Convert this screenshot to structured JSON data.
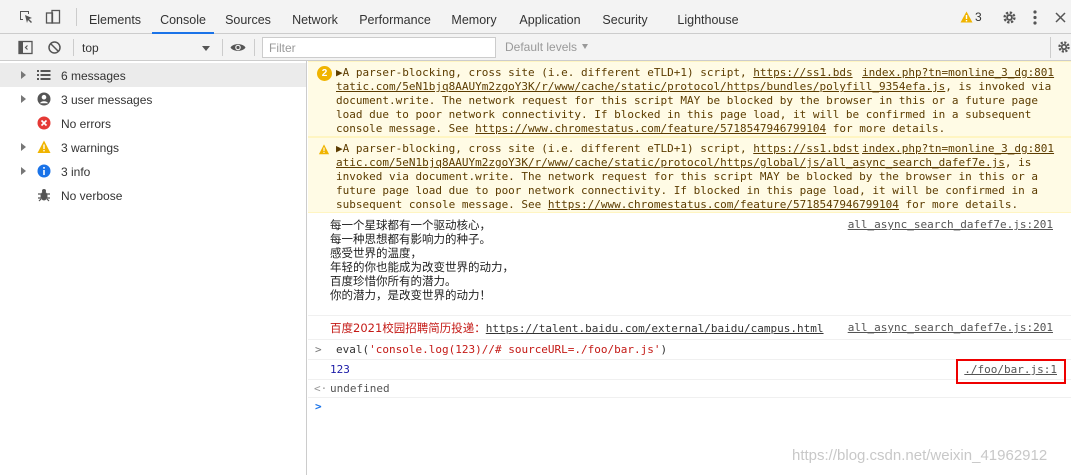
{
  "tabs": {
    "elements": "Elements",
    "console": "Console",
    "sources": "Sources",
    "network": "Network",
    "performance": "Performance",
    "memory": "Memory",
    "application": "Application",
    "security": "Security",
    "lighthouse": "Lighthouse"
  },
  "tabbar_right": {
    "warning_count": "3"
  },
  "toolbar": {
    "context": "top",
    "filter_placeholder": "Filter",
    "levels": "Default levels"
  },
  "sidebar": {
    "items": [
      {
        "label": "6 messages",
        "icon": "list-icon"
      },
      {
        "label": "3 user messages",
        "icon": "user-icon"
      },
      {
        "label": "No errors",
        "icon": "error-icon"
      },
      {
        "label": "3 warnings",
        "icon": "warning-icon"
      },
      {
        "label": "3 info",
        "icon": "info-icon"
      },
      {
        "label": "No verbose",
        "icon": "bug-icon"
      }
    ]
  },
  "console": {
    "warning1": {
      "count": "2",
      "l1a": "▶A parser-blocking, cross site (i.e. different eTLD+1) script, ",
      "l1b": "https://ss1.bds",
      "l1src": "index.php?tn=monline_3_dg:801",
      "l2a": "tatic.com/5eN1bjq8AAUYm2zgoY3K/r/www/cache/static/protocol/https/bundles/polyfill_9354efa.js",
      "l2b": ", is invoked via",
      "l3": "document.write. The network request for this script MAY be blocked by the browser in this or a future page",
      "l4": "load due to poor network connectivity. If blocked in this page load, it will be confirmed in a subsequent",
      "l5a": "console message. See ",
      "l5b": "https://www.chromestatus.com/feature/5718547946799104",
      "l5c": " for more details."
    },
    "warning2": {
      "l1a": "▶A parser-blocking, cross site (i.e. different eTLD+1) script, ",
      "l1b": "https://ss1.bdst",
      "l1src": "index.php?tn=monline_3_dg:801",
      "l2a": "atic.com/5eN1bjq8AAUYm2zgoY3K/r/www/cache/static/protocol/https/global/js/all_async_search_dafef7e.js",
      "l2b": ", is",
      "l3": "invoked via document.write. The network request for this script MAY be blocked by the browser in this or a",
      "l4": "future page load due to poor network connectivity. If blocked in this page load, it will be confirmed in a",
      "l5a": "subsequent console message. See ",
      "l5b": "https://www.chromestatus.com/feature/5718547946799104",
      "l5c": " for more details."
    },
    "poem": {
      "lines": [
        "每一个星球都有一个驱动核心，",
        "每一种思想都有影响力的种子。",
        "感受世界的温度，",
        "年轻的你也能成为改变世界的动力，",
        "百度珍惜你所有的潜力。",
        "你的潜力，是改变世界的动力！"
      ],
      "src": "all_async_search_dafef7e.js:201"
    },
    "recruit": {
      "label": "百度2021校园招聘简历投递：",
      "url": "https://talent.baidu.com/external/baidu/campus.html",
      "src": "all_async_search_dafef7e.js:201"
    },
    "input": {
      "prompt": ">",
      "a": "eval(",
      "b": "'console.log(123)//# sourceURL=./foo/bar.js'",
      "c": ")"
    },
    "output": {
      "value": "123",
      "src": "./foo/bar.js:1"
    },
    "result": {
      "prompt": "<·",
      "value": "undefined"
    },
    "caret": ">"
  },
  "watermark": "https://blog.csdn.net/weixin_41962912"
}
